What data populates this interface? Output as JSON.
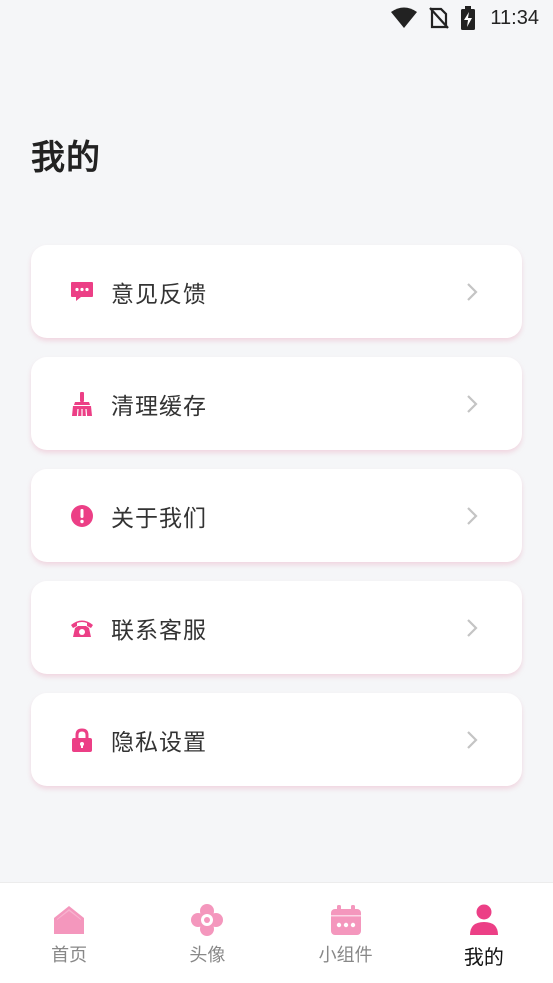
{
  "status_bar": {
    "time": "11:34"
  },
  "page": {
    "title": "我的"
  },
  "colors": {
    "accent": "#ec3f86",
    "accent_light": "#f497bd",
    "background": "#f5f6f8",
    "text_primary": "#333333",
    "nav_inactive": "#888888"
  },
  "menu": {
    "items": [
      {
        "label": "意见反馈",
        "icon": "feedback-icon"
      },
      {
        "label": "清理缓存",
        "icon": "broom-icon"
      },
      {
        "label": "关于我们",
        "icon": "info-alert-icon"
      },
      {
        "label": "联系客服",
        "icon": "telephone-icon"
      },
      {
        "label": "隐私设置",
        "icon": "lock-icon"
      }
    ]
  },
  "bottom_nav": {
    "items": [
      {
        "label": "首页",
        "icon": "home-icon",
        "active": false
      },
      {
        "label": "头像",
        "icon": "flower-icon",
        "active": false
      },
      {
        "label": "小组件",
        "icon": "calendar-widget-icon",
        "active": false
      },
      {
        "label": "我的",
        "icon": "person-icon",
        "active": true
      }
    ]
  }
}
